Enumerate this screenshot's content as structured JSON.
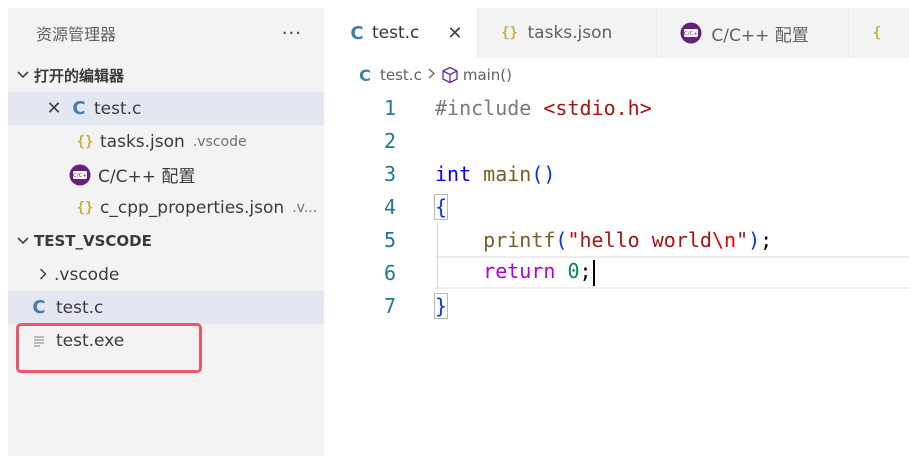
{
  "sidebar": {
    "title": "资源管理器",
    "more": "···",
    "open_editors": {
      "header": "打开的编辑器",
      "items": [
        {
          "name": "test.c",
          "desc": "",
          "icon": "c-file-icon",
          "active": true
        },
        {
          "name": "tasks.json",
          "desc": ".vscode",
          "icon": "json-icon"
        },
        {
          "name": "C/C++ 配置",
          "desc": "",
          "icon": "cpp-config-icon"
        },
        {
          "name": "c_cpp_properties.json",
          "desc": ".v...",
          "icon": "json-icon"
        }
      ]
    },
    "workspace": {
      "header": "TEST_VSCODE",
      "items": [
        {
          "name": ".vscode",
          "icon": "chevron-right-icon"
        },
        {
          "name": "test.c",
          "icon": "c-file-icon"
        },
        {
          "name": "test.exe",
          "icon": "file-icon"
        }
      ]
    }
  },
  "tabs": [
    {
      "label": "test.c",
      "icon": "c-file-icon",
      "active": true
    },
    {
      "label": "tasks.json",
      "icon": "json-icon"
    },
    {
      "label": "C/C++ 配置",
      "icon": "cpp-config-icon"
    },
    {
      "label": "{",
      "icon": "json-icon"
    }
  ],
  "breadcrumb": {
    "file": "test.c",
    "symbol": "main()"
  },
  "code": {
    "line_numbers": [
      "1",
      "2",
      "3",
      "4",
      "5",
      "6",
      "7"
    ],
    "l1_directive": "#include",
    "l1_header": "<stdio.h>",
    "l3_type": "int",
    "l3_func": "main",
    "l3_parens": "()",
    "l4_brace": "{",
    "l5_func": "printf",
    "l5_open": "(",
    "l5_str": "\"hello world",
    "l5_esc": "\\n",
    "l5_quote": "\"",
    "l5_close": ")",
    "l5_semi": ";",
    "l6_kw": "return",
    "l6_num": "0",
    "l6_semi": ";",
    "l7_brace": "}"
  },
  "colors": {
    "highlight_box": "#f0566a",
    "accent_c": "#3e7fae",
    "json": "#c5b43a",
    "cpp_icon": "#68217a"
  }
}
